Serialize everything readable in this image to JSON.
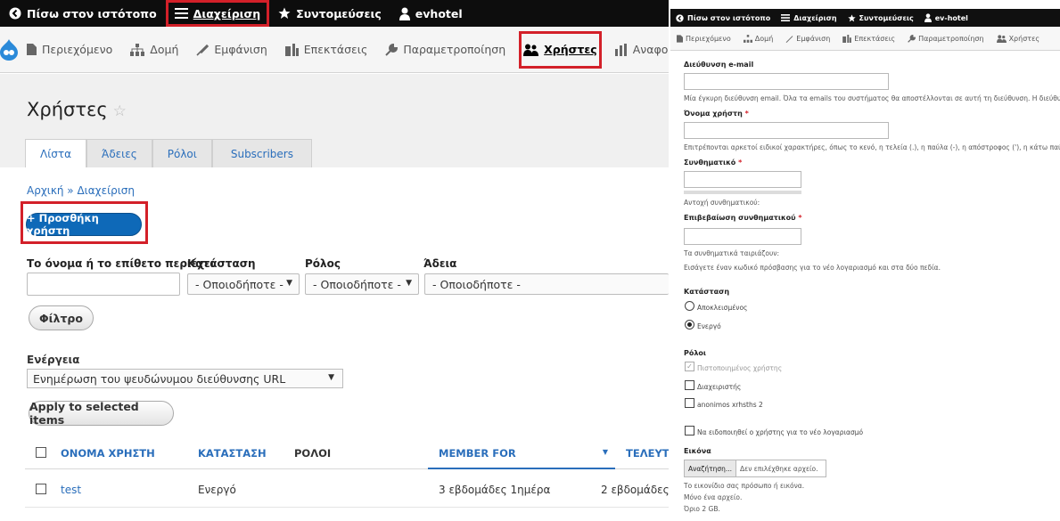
{
  "left": {
    "toolbar": {
      "back_label": "Πίσω στον ιστότοπο",
      "manage_label": "Διαχείριση",
      "shortcuts_label": "Συντομεύσεις",
      "user_label": "evhotel"
    },
    "tray": {
      "content": "Περιεχόμενο",
      "structure": "Δομή",
      "appearance": "Εμφάνιση",
      "extend": "Επεκτάσεις",
      "config": "Παραμετροποίηση",
      "people": "Χρήστες",
      "reports": "Αναφορές"
    },
    "page_title": "Χρήστες",
    "tabs": [
      "Λίστα",
      "Άδειες",
      "Ρόλοι",
      "Subscribers"
    ],
    "breadcrumb": "Αρχική » Διαχείριση",
    "add_user": "+ Προσθήκη χρήστη",
    "filters": {
      "name_label": "Το όνομα ή το επίθετο περιέχει",
      "status_label": "Κατάσταση",
      "role_label": "Ρόλος",
      "permission_label": "Άδεια",
      "status_value": "- Οποιοδήποτε -",
      "role_value": "- Οποιοδήποτε -",
      "permission_value": "- Οποιοδήποτε -",
      "filter_button": "Φίλτρο"
    },
    "action": {
      "label": "Ενέργεια",
      "value": "Ενημέρωση του ψευδώνυμου διεύθυνσης URL",
      "apply": "Apply to selected items"
    },
    "table": {
      "headers": [
        "ΟΝΟΜΑ ΧΡΗΣΤΗ",
        "ΚΑΤΑΣΤΑΣΗ",
        "ΡΟΛΟΙ",
        "MEMBER FOR",
        "ΤΕΛΕΥΤΑΙΑ Π"
      ],
      "rows": [
        {
          "name": "test",
          "status": "Ενεργό",
          "roles": "",
          "member_for": "3 εβδομάδες 1ημέρα",
          "last": "2 εβδομάδες"
        }
      ]
    }
  },
  "right": {
    "toolbar": {
      "back_label": "Πίσω στον ιστότοπο",
      "manage_label": "Διαχείριση",
      "shortcuts_label": "Συντομεύσεις",
      "user_label": "ev-hotel"
    },
    "tray": {
      "content": "Περιεχόμενο",
      "structure": "Δομή",
      "appearance": "Εμφάνιση",
      "extend": "Επεκτάσεις",
      "config": "Παραμετροποίηση",
      "people": "Χρήστες"
    },
    "form": {
      "email_label": "Διεύθυνση e-mail",
      "email_desc": "Μία έγκυρη διεύθυνση email. Όλα τα emails του συστήματος θα αποστέλλονται σε αυτή τη διεύθυνση. Η διεύθυνση επ",
      "username_label": "Όνομα χρήστη",
      "username_desc": "Επιτρέπονται αρκετοί ειδικοί χαρακτήρες, όπως το κενό, η τελεία (.), η παύλα (-), η απόστροφος ('), η κάτω παύλα (_)",
      "password_label": "Συνθηματικό",
      "password_strength": "Αντοχή συνθηματικού:",
      "confirm_label": "Επιβεβαίωση συνθηματικού",
      "passwords_match": "Τα συνθηματικά ταιριάζουν:",
      "password_desc": "Εισάγετε έναν κωδικό πρόσβασης για το νέο λογαριασμό και στα δύο πεδία.",
      "required_mark": "*",
      "status_label": "Κατάσταση",
      "status_blocked": "Αποκλεισμένος",
      "status_active": "Ενεργό",
      "roles_label": "Ρόλοι",
      "role_auth": "Πιστοποιημένος χρήστης",
      "role_admin": "Διαχειριστής",
      "role_anon": "anonimos xrhsths 2",
      "notify": "Να ειδοποιηθεί ο χρήστης για το νέο λογαριασμό",
      "picture_label": "Εικόνα",
      "browse": "Αναζήτηση...",
      "no_file": "Δεν επιλέχθηκε αρχείο.",
      "picture_desc": "Το εικονίδιο σας πρόσωπο ή εικόνα.",
      "one_file": "Μόνο ένα αρχείο.",
      "limit": "Όριο 2 GB."
    }
  },
  "colors": {
    "toolbar": "#0d0d0d",
    "link": "#2a6ebb",
    "primary_button": "#0e69b8",
    "highlight": "#d32029"
  }
}
